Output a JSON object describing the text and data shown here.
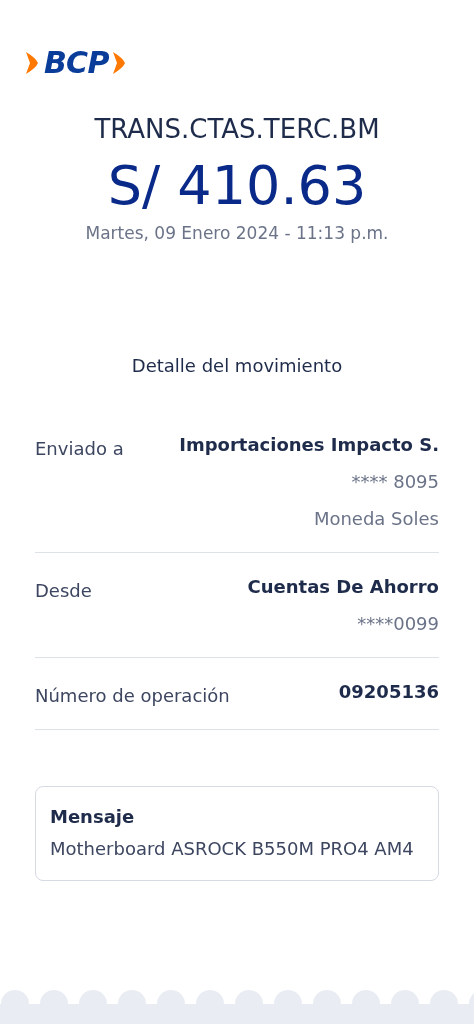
{
  "logo": {
    "text": "BCP"
  },
  "title": "TRANS.CTAS.TERC.BM",
  "amount": "S/ 410.63",
  "date": "Martes, 09 Enero 2024 - 11:13 p.m.",
  "detail_heading": "Detalle del movimiento",
  "details": [
    {
      "label": "Enviado a",
      "values": [
        "Importaciones Impacto S.",
        "**** 8095",
        "Moneda Soles"
      ]
    },
    {
      "label": "Desde",
      "values": [
        "Cuentas De Ahorro",
        "****0099"
      ]
    },
    {
      "label": "Número de operación",
      "values": [
        "09205136"
      ]
    }
  ],
  "message": {
    "title": "Mensaje",
    "text": "Motherboard ASROCK B550M PRO4 AM4"
  }
}
